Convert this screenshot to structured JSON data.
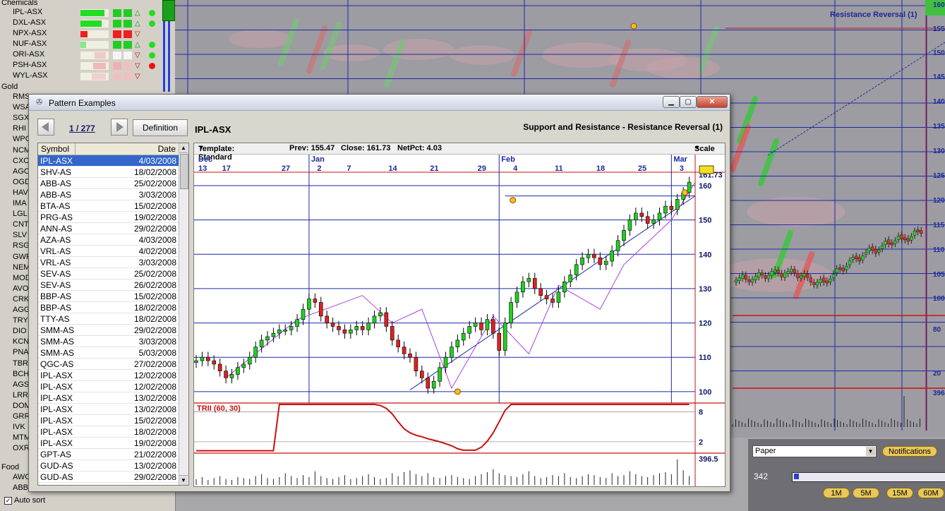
{
  "watchlist": {
    "section_chemicals": "Chemicals",
    "section_gold": "Gold",
    "section_food": "Food",
    "items": [
      "IPL-ASX",
      "DXL-ASX",
      "NPX-ASX",
      "NUF-ASX",
      "ORI-ASX",
      "PSH-ASX",
      "WYL-ASX"
    ],
    "gold_codes": [
      "RMS",
      "WSA",
      "SGX",
      "RHI",
      "WPG",
      "NCM",
      "CXO",
      "AGO",
      "OGD",
      "HAV",
      "IMA",
      "LGL",
      "CNT",
      "SLV",
      "RSG",
      "GWR",
      "NEM",
      "MOD",
      "AVO",
      "CRK",
      "AGG",
      "TRY",
      "DIO",
      "KCN",
      "PNA",
      "TBR",
      "BCH",
      "AGS",
      "LRR",
      "DOM",
      "GRR",
      "IVK",
      "MTM",
      "OXR"
    ],
    "food_codes": [
      "AWC",
      "ABB"
    ],
    "auto_sort": "Auto sort"
  },
  "background_chart": {
    "title": "Resistance Reversal (1)",
    "y_labels": [
      "160",
      "155",
      "150",
      "145",
      "140",
      "135",
      "130",
      "125",
      "120",
      "115",
      "110",
      "105",
      "100",
      "80",
      "20",
      "396"
    ],
    "colors": {
      "grid": "#1e2aa8",
      "alert": "#d01010"
    }
  },
  "bottom_panel": {
    "combo_value": "Paper",
    "notifications": "Notifications",
    "value": "342",
    "intervals": [
      "1M",
      "5M",
      "15M",
      "60M"
    ]
  },
  "dialog": {
    "title": "Pattern Examples",
    "counter": "1 / 277",
    "definition_button": "Definition",
    "symbol": "IPL-ASX",
    "pattern": "Support and Resistance - Resistance Reversal (1)",
    "list_headers": {
      "symbol": "Symbol",
      "date": "Date"
    },
    "rows": [
      {
        "s": "IPL-ASX",
        "d": "4/03/2008"
      },
      {
        "s": "SHV-AS",
        "d": "18/02/2008"
      },
      {
        "s": "ABB-AS",
        "d": "25/02/2008"
      },
      {
        "s": "ABB-AS",
        "d": "3/03/2008"
      },
      {
        "s": "BTA-AS",
        "d": "15/02/2008"
      },
      {
        "s": "PRG-AS",
        "d": "19/02/2008"
      },
      {
        "s": "ANN-AS",
        "d": "29/02/2008"
      },
      {
        "s": "AZA-AS",
        "d": "4/03/2008"
      },
      {
        "s": "VRL-AS",
        "d": "4/02/2008"
      },
      {
        "s": "VRL-AS",
        "d": "3/03/2008"
      },
      {
        "s": "SEV-AS",
        "d": "25/02/2008"
      },
      {
        "s": "SEV-AS",
        "d": "26/02/2008"
      },
      {
        "s": "BBP-AS",
        "d": "15/02/2008"
      },
      {
        "s": "BBP-AS",
        "d": "18/02/2008"
      },
      {
        "s": "TTY-AS",
        "d": "18/02/2008"
      },
      {
        "s": "SMM-AS",
        "d": "29/02/2008"
      },
      {
        "s": "SMM-AS",
        "d": "3/03/2008"
      },
      {
        "s": "SMM-AS",
        "d": "5/03/2008"
      },
      {
        "s": "QGC-AS",
        "d": "27/02/2008"
      },
      {
        "s": "IPL-ASX",
        "d": "12/02/2008"
      },
      {
        "s": "IPL-ASX",
        "d": "12/02/2008"
      },
      {
        "s": "IPL-ASX",
        "d": "13/02/2008"
      },
      {
        "s": "IPL-ASX",
        "d": "13/02/2008"
      },
      {
        "s": "IPL-ASX",
        "d": "15/02/2008"
      },
      {
        "s": "IPL-ASX",
        "d": "18/02/2008"
      },
      {
        "s": "IPL-ASX",
        "d": "19/02/2008"
      },
      {
        "s": "GPT-AS",
        "d": "21/02/2008"
      },
      {
        "s": "GUD-AS",
        "d": "13/02/2008"
      },
      {
        "s": "GUD-AS",
        "d": "29/02/2008"
      }
    ],
    "toolbar": {
      "template": "Template: Standard",
      "prev": "Prev: 155.47",
      "close": "Close: 161.73",
      "netpct": "NetPct: 4.03",
      "scale": "Scale"
    },
    "indicator_label": "TRII (60, 30)"
  },
  "chart_data": {
    "type": "candlestick",
    "months": [
      {
        "label": "Dec",
        "day": 0
      },
      {
        "label": "Jan",
        "day": 19
      },
      {
        "label": "Feb",
        "day": 51
      },
      {
        "label": "Mar",
        "day": 80
      }
    ],
    "day_ticks": [
      {
        "day": 0,
        "label": "13"
      },
      {
        "day": 4,
        "label": "17"
      },
      {
        "day": 14,
        "label": "27"
      },
      {
        "day": 20,
        "label": "2"
      },
      {
        "day": 25,
        "label": "7"
      },
      {
        "day": 32,
        "label": "14"
      },
      {
        "day": 39,
        "label": "21"
      },
      {
        "day": 47,
        "label": "29"
      },
      {
        "day": 53,
        "label": "4"
      },
      {
        "day": 60,
        "label": "11"
      },
      {
        "day": 67,
        "label": "18"
      },
      {
        "day": 74,
        "label": "25"
      },
      {
        "day": 81,
        "label": "3"
      }
    ],
    "x_range": [
      0,
      84
    ],
    "ylim": [
      97.5,
      163.5
    ],
    "y_ticks": [
      100,
      110,
      120,
      130,
      140,
      150,
      160
    ],
    "last_price": "161.73",
    "resistance_level": 157,
    "trend_line": [
      {
        "day": 36,
        "price": 100.5
      },
      {
        "day": 84,
        "price": 157
      }
    ],
    "zigzag": [
      [
        5,
        104
      ],
      [
        17,
        121
      ],
      [
        28,
        128
      ],
      [
        33,
        120
      ],
      [
        38,
        124
      ],
      [
        43,
        101
      ],
      [
        50,
        122
      ],
      [
        56,
        111
      ],
      [
        61,
        131
      ],
      [
        68,
        124
      ],
      [
        72,
        137
      ],
      [
        80,
        150
      ],
      [
        84,
        161
      ]
    ],
    "closes": [
      109,
      110,
      109,
      108,
      106,
      104,
      105,
      107,
      108,
      110,
      113,
      115,
      116,
      117,
      118,
      118,
      119,
      121,
      124,
      127,
      126,
      122,
      120,
      119,
      118,
      117,
      118,
      119,
      118,
      120,
      122,
      123,
      119,
      115,
      113,
      111,
      110,
      106,
      104,
      101,
      103,
      107,
      110,
      113,
      115,
      117,
      119,
      120,
      118,
      121,
      117,
      112,
      120,
      126,
      129,
      132,
      133,
      130,
      128,
      127,
      126,
      129,
      132,
      134,
      137,
      139,
      140,
      139,
      137,
      138,
      141,
      144,
      147,
      150,
      152,
      151,
      149,
      150,
      152,
      154,
      153,
      156,
      158,
      161
    ],
    "volume": [
      6,
      8,
      5,
      7,
      9,
      6,
      5,
      8,
      7,
      6,
      9,
      11,
      7,
      6,
      8,
      12,
      9,
      7,
      10,
      8,
      14,
      9,
      7,
      6,
      8,
      10,
      6,
      7,
      9,
      11,
      8,
      6,
      7,
      12,
      9,
      13,
      15,
      11,
      9,
      12,
      8,
      7,
      9,
      10,
      8,
      7,
      6,
      9,
      11,
      13,
      16,
      12,
      10,
      9,
      8,
      11,
      14,
      9,
      7,
      8,
      10,
      9,
      12,
      8,
      7,
      9,
      11,
      10,
      8,
      7,
      12,
      9,
      10,
      14,
      11,
      9,
      8,
      10,
      12,
      13,
      11,
      26,
      15,
      9
    ],
    "volume_label": "396.5",
    "indicator": {
      "name": "TRII (60, 30)",
      "ticks": [
        8,
        2
      ],
      "ylim": [
        0,
        9.5
      ],
      "values": [
        0.2,
        0.2,
        0.2,
        0.2,
        0.2,
        0.2,
        0.2,
        0.2,
        0.2,
        0.2,
        0.2,
        0.2,
        0.2,
        0.2,
        9.5,
        9.5,
        9.5,
        9.5,
        9.5,
        9.5,
        9.5,
        9.5,
        9.5,
        9.5,
        9.5,
        9.5,
        9.5,
        9.5,
        9.5,
        9.5,
        9.5,
        9.3,
        8.7,
        7.6,
        6.0,
        4.6,
        3.8,
        3.3,
        3.0,
        2.6,
        2.3,
        2.0,
        1.6,
        1.2,
        0.6,
        0.3,
        0.3,
        0.3,
        0.9,
        2.1,
        3.8,
        6.0,
        8.3,
        9.5,
        9.5,
        9.5,
        9.5,
        9.5,
        9.5,
        9.5,
        9.5,
        9.5,
        9.5,
        9.5,
        9.5,
        9.5,
        9.5,
        9.5,
        9.5,
        9.5,
        9.5,
        9.5,
        9.5,
        9.5,
        9.5,
        9.5,
        9.5,
        9.5,
        9.5,
        9.5,
        9.5,
        9.5,
        9.5,
        9.5
      ]
    }
  }
}
